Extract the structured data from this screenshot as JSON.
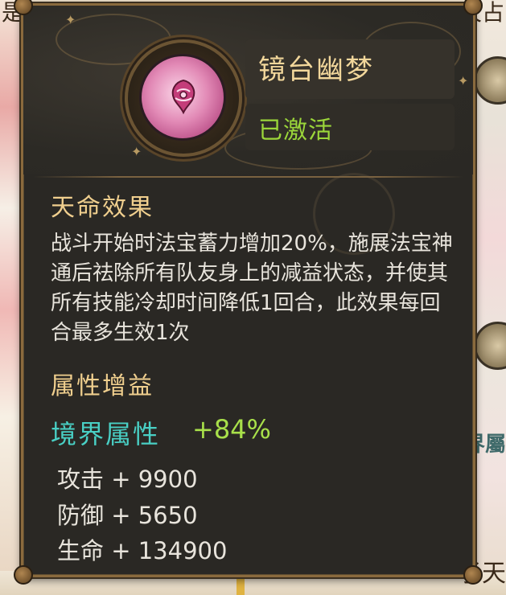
{
  "background": {
    "top_left_text": "是",
    "top_right_text": "天占",
    "right_attr_text": "境界屬",
    "bottom_right_text": "子天"
  },
  "tooltip": {
    "title": "镜台幽梦",
    "status": "已激活",
    "effect_section": {
      "heading": "天命效果",
      "description": "战斗开始时法宝蓄力增加20%，施展法宝神通后祛除所有队友身上的减益状态，并使其所有技能冷却时间降低1回合，此效果每回合最多生效1次"
    },
    "attribute_section": {
      "heading": "属性增益",
      "realm_label": "境界属性",
      "realm_value": "+84%",
      "stats": [
        {
          "text": "攻击 + 9900"
        },
        {
          "text": "防御 + 5650"
        },
        {
          "text": "生命 + 134900"
        }
      ]
    }
  },
  "colors": {
    "title": "#f2d79b",
    "status": "#9bd63a",
    "heading": "#f0cf8e",
    "realm_label": "#49d0c5",
    "realm_value": "#a8e04a",
    "body_text": "#e8e4dc",
    "panel_bg": "#2a2824",
    "border": "#8a6a3d"
  },
  "icons": {
    "artifact": "pink-mirror-artifact-icon"
  }
}
